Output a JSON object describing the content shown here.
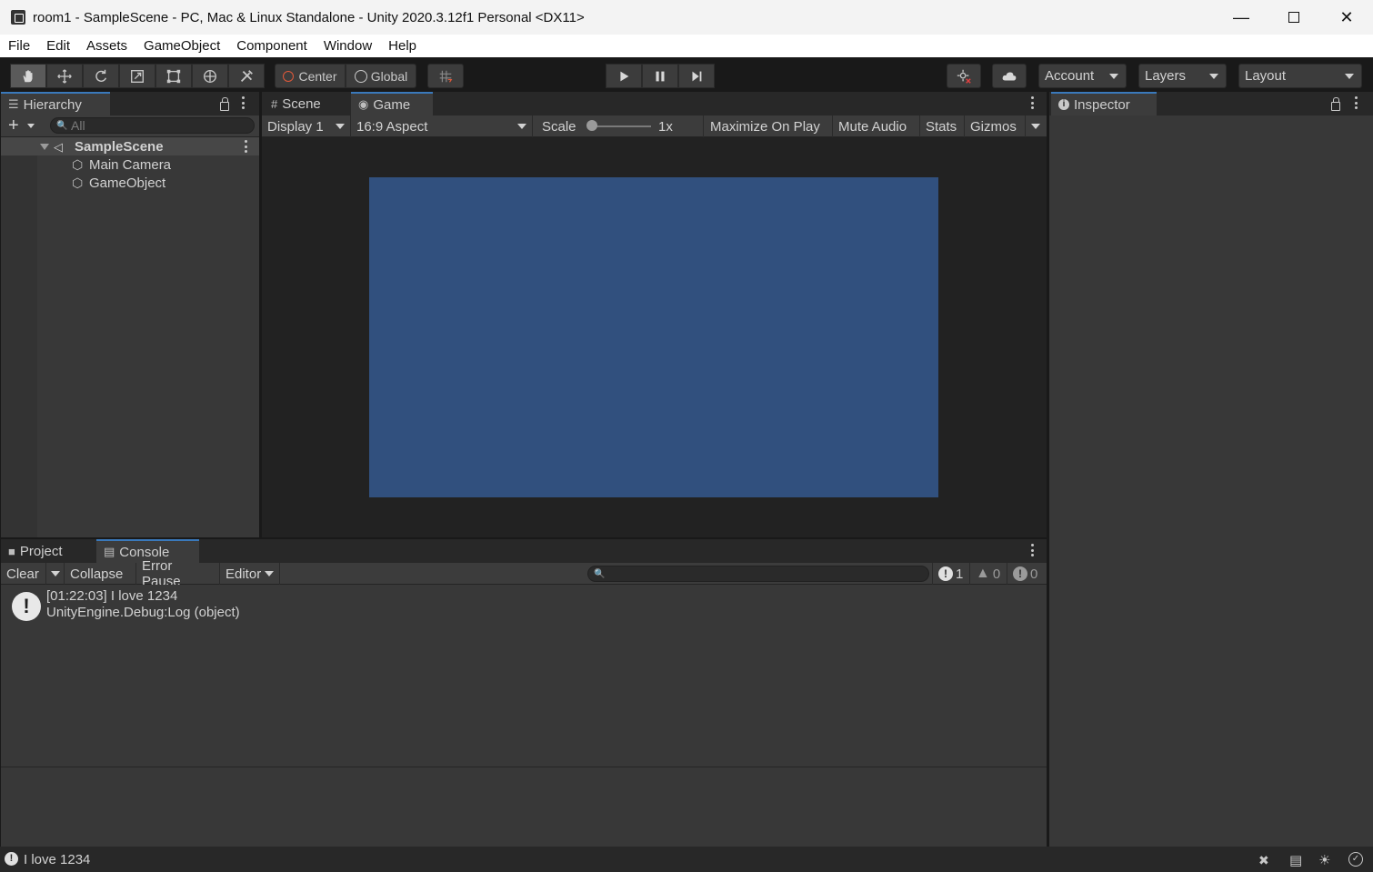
{
  "window": {
    "title": "room1 - SampleScene - PC, Mac & Linux Standalone - Unity 2020.3.12f1 Personal <DX11>",
    "minimize_icon": "minimize-icon",
    "maximize_icon": "maximize-icon",
    "close_icon": "close-icon"
  },
  "menu": {
    "items": [
      "File",
      "Edit",
      "Assets",
      "GameObject",
      "Component",
      "Window",
      "Help"
    ]
  },
  "toolbar": {
    "tools": [
      "hand-tool-icon",
      "move-tool-icon",
      "rotate-tool-icon",
      "scale-tool-icon",
      "rect-tool-icon",
      "transform-tool-icon",
      "custom-tool-icon"
    ],
    "pivot_label": "Center",
    "space_label": "Global",
    "account_label": "Account",
    "layers_label": "Layers",
    "layout_label": "Layout"
  },
  "hierarchy": {
    "tab_label": "Hierarchy",
    "search_placeholder": "All",
    "scene_name": "SampleScene",
    "items": [
      "Main Camera",
      "GameObject"
    ]
  },
  "game_view": {
    "tabs": [
      "Scene",
      "Game"
    ],
    "display_label": "Display 1",
    "aspect_label": "16:9 Aspect",
    "scale_label": "Scale",
    "scale_value": "1x",
    "maximize_label": "Maximize On Play",
    "mute_label": "Mute Audio",
    "stats_label": "Stats",
    "gizmos_label": "Gizmos",
    "camera_background": "#31507e"
  },
  "inspector": {
    "tab_label": "Inspector"
  },
  "console": {
    "tabs": [
      "Project",
      "Console"
    ],
    "clear_label": "Clear",
    "collapse_label": "Collapse",
    "error_pause_label": "Error Pause",
    "editor_label": "Editor",
    "log_count": "1",
    "warning_count": "0",
    "error_count": "0",
    "entries": [
      {
        "line1": "[01:22:03] I love 1234",
        "line2": "UnityEngine.Debug:Log (object)"
      }
    ]
  },
  "status": {
    "message": "I love 1234"
  },
  "colors": {
    "accent": "#3a79bb",
    "panel": "#383838",
    "dark": "#191919"
  }
}
